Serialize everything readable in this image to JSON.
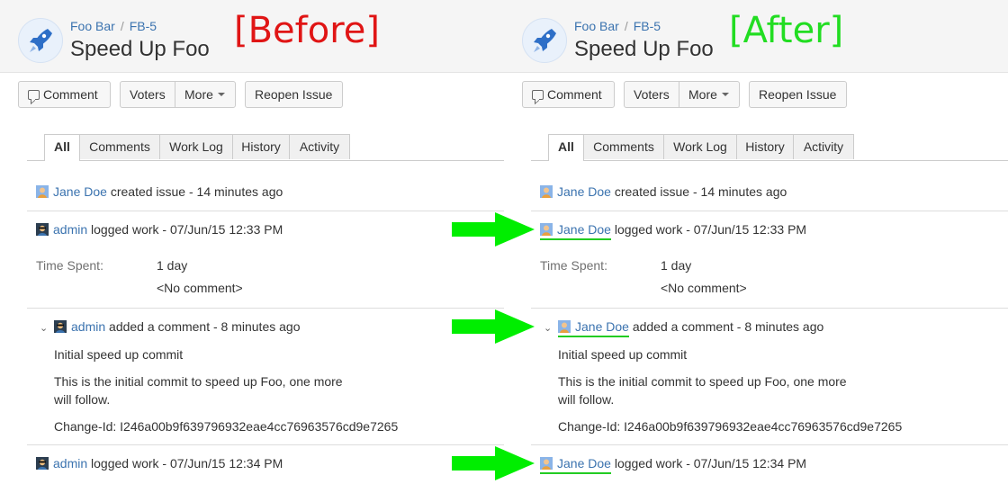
{
  "before": {
    "label": "[Before]",
    "crumbs": {
      "project": "Foo Bar",
      "issue": "FB-5"
    },
    "title": "Speed Up Foo",
    "buttons": {
      "comment": "Comment",
      "voters": "Voters",
      "more": "More",
      "reopen": "Reopen Issue"
    },
    "tabs": [
      "All",
      "Comments",
      "Work Log",
      "History",
      "Activity"
    ],
    "activity": {
      "created": {
        "user": "Jane Doe",
        "text": "created issue - 14 minutes ago"
      },
      "worklog1": {
        "user": "admin",
        "text": "logged work - 07/Jun/15 12:33 PM",
        "time_label": "Time Spent:",
        "time_value": "1 day",
        "comment": "<No comment>"
      },
      "comment": {
        "user": "admin",
        "text": "added a comment - 8 minutes ago",
        "line1": "Initial speed up commit",
        "line2a": "This is the initial commit to speed up Foo, one more",
        "line2b": "will follow.",
        "change_id": "Change-Id: I246a00b9f639796932eae4cc76963576cd9e7265"
      },
      "worklog2": {
        "user": "admin",
        "text": "logged work - 07/Jun/15 12:34 PM"
      }
    }
  },
  "after": {
    "label": "[After]",
    "crumbs": {
      "project": "Foo Bar",
      "issue": "FB-5"
    },
    "title": "Speed Up Foo",
    "buttons": {
      "comment": "Comment",
      "voters": "Voters",
      "more": "More",
      "reopen": "Reopen Issue"
    },
    "tabs": [
      "All",
      "Comments",
      "Work Log",
      "History",
      "Activity"
    ],
    "activity": {
      "created": {
        "user": "Jane Doe",
        "text": "created issue - 14 minutes ago"
      },
      "worklog1": {
        "user": "Jane Doe",
        "text": "logged work - 07/Jun/15 12:33 PM",
        "time_label": "Time Spent:",
        "time_value": "1 day",
        "comment": "<No comment>"
      },
      "comment": {
        "user": "Jane Doe",
        "text": "added a comment - 8 minutes ago",
        "line1": "Initial speed up commit",
        "line2a": "This is the initial commit to speed up Foo, one more",
        "line2b": "will follow.",
        "change_id": "Change-Id: I246a00b9f639796932eae4cc76963576cd9e7265"
      },
      "worklog2": {
        "user": "Jane Doe",
        "text": "logged work - 07/Jun/15 12:34 PM"
      }
    }
  },
  "colors": {
    "before_label": "#e01515",
    "after_label": "#22dd22",
    "arrow": "#00ee00",
    "link": "#3b73af"
  }
}
